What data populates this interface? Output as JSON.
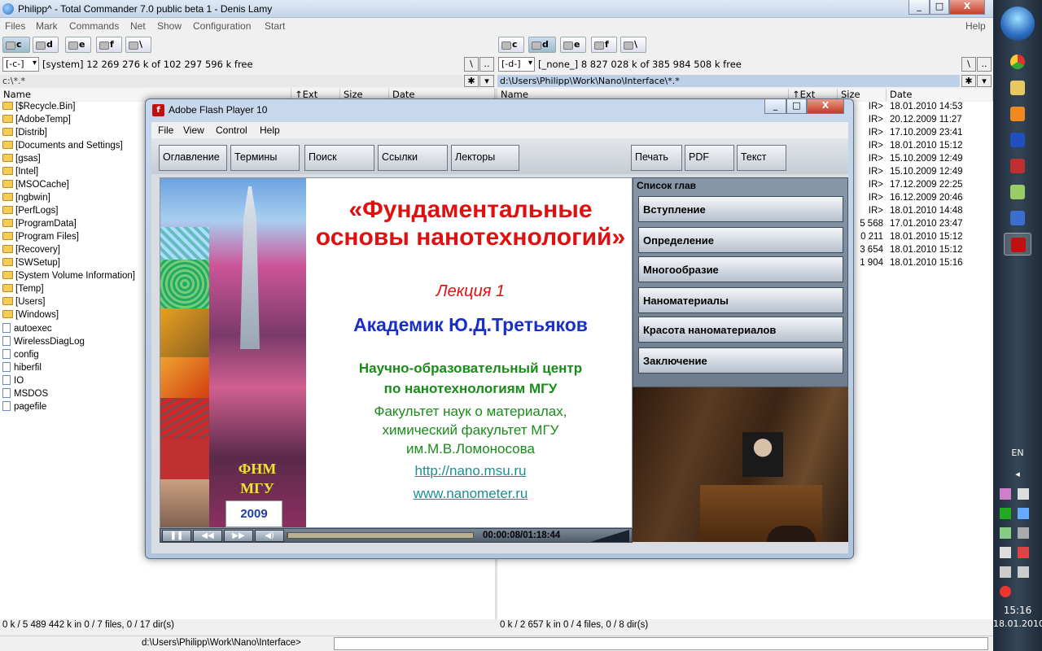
{
  "window": {
    "title": "Philipp^ - Total Commander 7.0 public beta 1 - Denis Lamy",
    "min": "_",
    "max": "□",
    "close": "X"
  },
  "menu": [
    "Files",
    "Mark",
    "Commands",
    "Net",
    "Show",
    "Configuration",
    "Start"
  ],
  "help": "Help",
  "left": {
    "drives": [
      "c",
      "d",
      "e",
      "f",
      "\\"
    ],
    "drive_combo": "[-c-]",
    "info": "[system]  12 269 276 k of  102 297 596 k free",
    "path": "c:\\*.*",
    "columns": {
      "name": "Name",
      "ext": "↑Ext",
      "size": "Size",
      "date": "Date"
    },
    "files": [
      "[$Recycle.Bin]",
      "[AdobeTemp]",
      "[Distrib]",
      "[Documents and Settings]",
      "[gsas]",
      "[Intel]",
      "[MSOCache]",
      "[ngbwin]",
      "[PerfLogs]",
      "[ProgramData]",
      "[Program Files]",
      "[Recovery]",
      "[SWSetup]",
      "[System Volume Information]",
      "[Temp]",
      "[Users]",
      "[Windows]",
      "autoexec",
      "WirelessDiagLog",
      "config",
      "hiberfil",
      "IO",
      "MSDOS",
      "pagefile"
    ],
    "status": "0 k / 5 489 442 k in 0 / 7 files, 0 / 17 dir(s)"
  },
  "right": {
    "drives": [
      "c",
      "d",
      "e",
      "f",
      "\\"
    ],
    "drive_combo": "[-d-]",
    "info": "[_none_]  8 827 028 k of  385 984 508 k free",
    "path": "d:\\Users\\Philipp\\Work\\Nano\\Interface\\*.*",
    "columns": {
      "name": "Name",
      "ext": "↑Ext",
      "size": "Size",
      "date": "Date"
    },
    "sizes": [
      "IR>",
      "IR>",
      "IR>",
      "IR>",
      "IR>",
      "IR>",
      "IR>",
      "IR>",
      "IR>",
      "5 568",
      "0 211",
      "3 654",
      "1 904"
    ],
    "dates": [
      "18.01.2010 14:53",
      "20.12.2009 11:27",
      "17.10.2009 23:41",
      "18.01.2010 15:12",
      "15.10.2009 12:49",
      "15.10.2009 12:49",
      "17.12.2009 22:25",
      "16.12.2009 20:46",
      "18.01.2010 14:48",
      "17.01.2010 23:47",
      "18.01.2010 15:12",
      "18.01.2010 15:12",
      "18.01.2010 15:16"
    ],
    "status": "0 k / 2 657 k in 0 / 4 files, 0 / 8 dir(s)"
  },
  "cmdline": "d:\\Users\\Philipp\\Work\\Nano\\Interface>",
  "flash": {
    "title": "Adobe Flash Player 10",
    "menu": [
      "File",
      "View",
      "Control",
      "Help"
    ],
    "nav": [
      "Оглавление",
      "Термины",
      "Поиск",
      "Ссылки",
      "Лекторы",
      "Печать",
      "PDF",
      "Текст"
    ],
    "slide": {
      "title": "«Фундаментальные основы нанотехнологий»",
      "lecture": "Лекция 1",
      "author": "Академик Ю.Д.Третьяков",
      "center": "Научно-образовательный центр по нанотехнологиям МГУ",
      "faculty": "Факультет наук о материалах, химический факультет МГУ им.М.В.Ломоносова",
      "link1": "http://nano.msu.ru",
      "link2": "www.nanometer.ru",
      "badge": "ФНМ МГУ",
      "year": "2009"
    },
    "chapters_title": "Список глав",
    "chapters": [
      "Вступление",
      "Определение",
      "Многообразие",
      "Наноматериалы",
      "Красота наноматериалов",
      "Заключение"
    ],
    "time": "00:00:08/01:18:44",
    "progress": 0.002
  },
  "tray": {
    "lang": "EN",
    "time": "15:16",
    "date": "18.01.2010"
  },
  "colors": {
    "slide_title": "#e01010",
    "author": "#1a2fc8",
    "center": "#1a8a1a",
    "link": "#1a9090"
  }
}
